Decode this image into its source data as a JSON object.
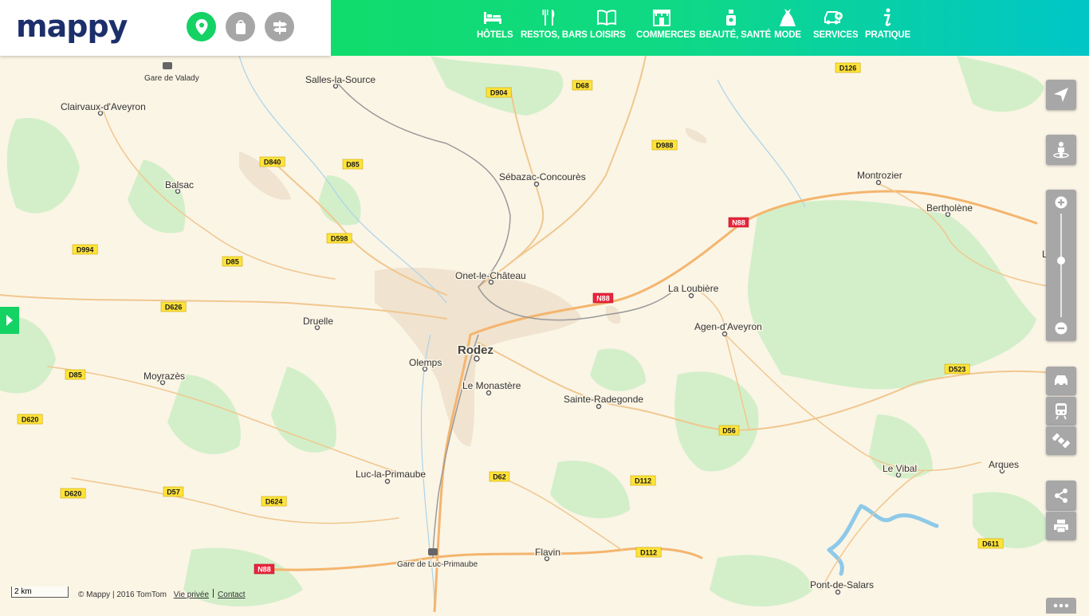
{
  "brand": {
    "logo_text": "mappy"
  },
  "header": {
    "mode_buttons": [
      {
        "name": "map-marker",
        "active": true
      },
      {
        "name": "shopping-bag",
        "active": false
      },
      {
        "name": "directions-signpost",
        "active": false
      }
    ],
    "categories": [
      {
        "label": "HÔTELS",
        "icon": "bed-icon"
      },
      {
        "label": "RESTOS, BARS",
        "icon": "cutlery-icon"
      },
      {
        "label": "LOISIRS",
        "icon": "book-icon"
      },
      {
        "label": "COMMERCES",
        "icon": "shop-icon"
      },
      {
        "label": "BEAUTÉ, SANTÉ",
        "icon": "bottle-icon"
      },
      {
        "label": "MODE",
        "icon": "dress-icon"
      },
      {
        "label": "SERVICES",
        "icon": "car-service-icon"
      },
      {
        "label": "PRATIQUE",
        "icon": "info-icon"
      }
    ]
  },
  "map": {
    "city_main": "Rodez",
    "places": [
      "Salles-la-Source",
      "Gare de Valady",
      "Clairvaux-d'Aveyron",
      "Balsac",
      "Sébazac-Concourès",
      "Montrozier",
      "Bertholène",
      "Onet-le-Château",
      "La Loubière",
      "Agen-d'Aveyron",
      "Druelle",
      "Olemps",
      "Le Monastère",
      "Sainte-Radegonde",
      "Moyrazès",
      "Luc-la-Primaube",
      "Le Vibal",
      "Arques",
      "Flavin",
      "Gare de Luc-Primaube",
      "Pont-de-Salars",
      "Laissac"
    ],
    "roads": [
      "D904",
      "D68",
      "D126",
      "D988",
      "D840",
      "D85",
      "D598",
      "D994",
      "D85",
      "N88",
      "D626",
      "N88",
      "D85",
      "D523",
      "D620",
      "D56",
      "D62",
      "D112",
      "D620",
      "D57",
      "D624",
      "D112",
      "D611",
      "N88"
    ],
    "scale_label": "2 km"
  },
  "controls": {
    "right_tools": [
      "locate-arrow-icon",
      "pegman-icon",
      "traffic-car-icon",
      "train-icon",
      "satellite-icon",
      "share-icon",
      "print-icon"
    ],
    "zoom_plus": "+",
    "zoom_minus": "−",
    "zoom_level": 0.45
  },
  "footer": {
    "copyright": "© Mappy | 2016 TomTom",
    "privacy_link": "Vie privée",
    "contact_link": "Contact"
  },
  "colors": {
    "background": "#fbf5e6",
    "forest": "#d3efc9",
    "urban": "#f0e3cf",
    "road_major": "#f4b56e",
    "road_minor": "#f0c78f",
    "water": "#8ec9e8",
    "brand_green": "#14d264",
    "road_label_d": "#ffe33a",
    "road_label_n": "#e8243c",
    "header_gradient_end": "#00c6c8"
  }
}
